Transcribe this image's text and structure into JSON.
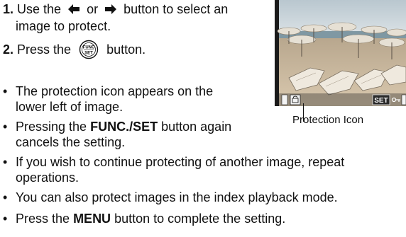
{
  "step1": {
    "number": "1.",
    "text_before": "Use the",
    "text_or": "or",
    "text_after": "button to select an",
    "text_line2": "image to protect."
  },
  "step2": {
    "number": "2.",
    "text_before": "Press the",
    "text_after": "button."
  },
  "func_button": {
    "top_text": "FUNC",
    "bottom_text": "SET"
  },
  "bullets": [
    {
      "line1": "The protection icon appears on the",
      "line2": "lower left of image."
    },
    {
      "line1_before": "Pressing the",
      "line1_bold": "FUNC./SET",
      "line1_after": "button again",
      "line2": "cancels the setting."
    },
    {
      "line1": "If you wish to continue protecting of another image, repeat",
      "line2": "operations."
    },
    {
      "line1": "You can also protect images in the index playback mode."
    },
    {
      "line1_before": "Press the",
      "line1_bold": "MENU",
      "line1_after": "button to complete the setting."
    }
  ],
  "photo": {
    "overlay_set": "SET",
    "callout_label": "Protection Icon"
  },
  "colors": {
    "text": "#111111",
    "sky": "#c8d6de",
    "sea": "#7f98a3",
    "sand": "#cbb79c"
  }
}
